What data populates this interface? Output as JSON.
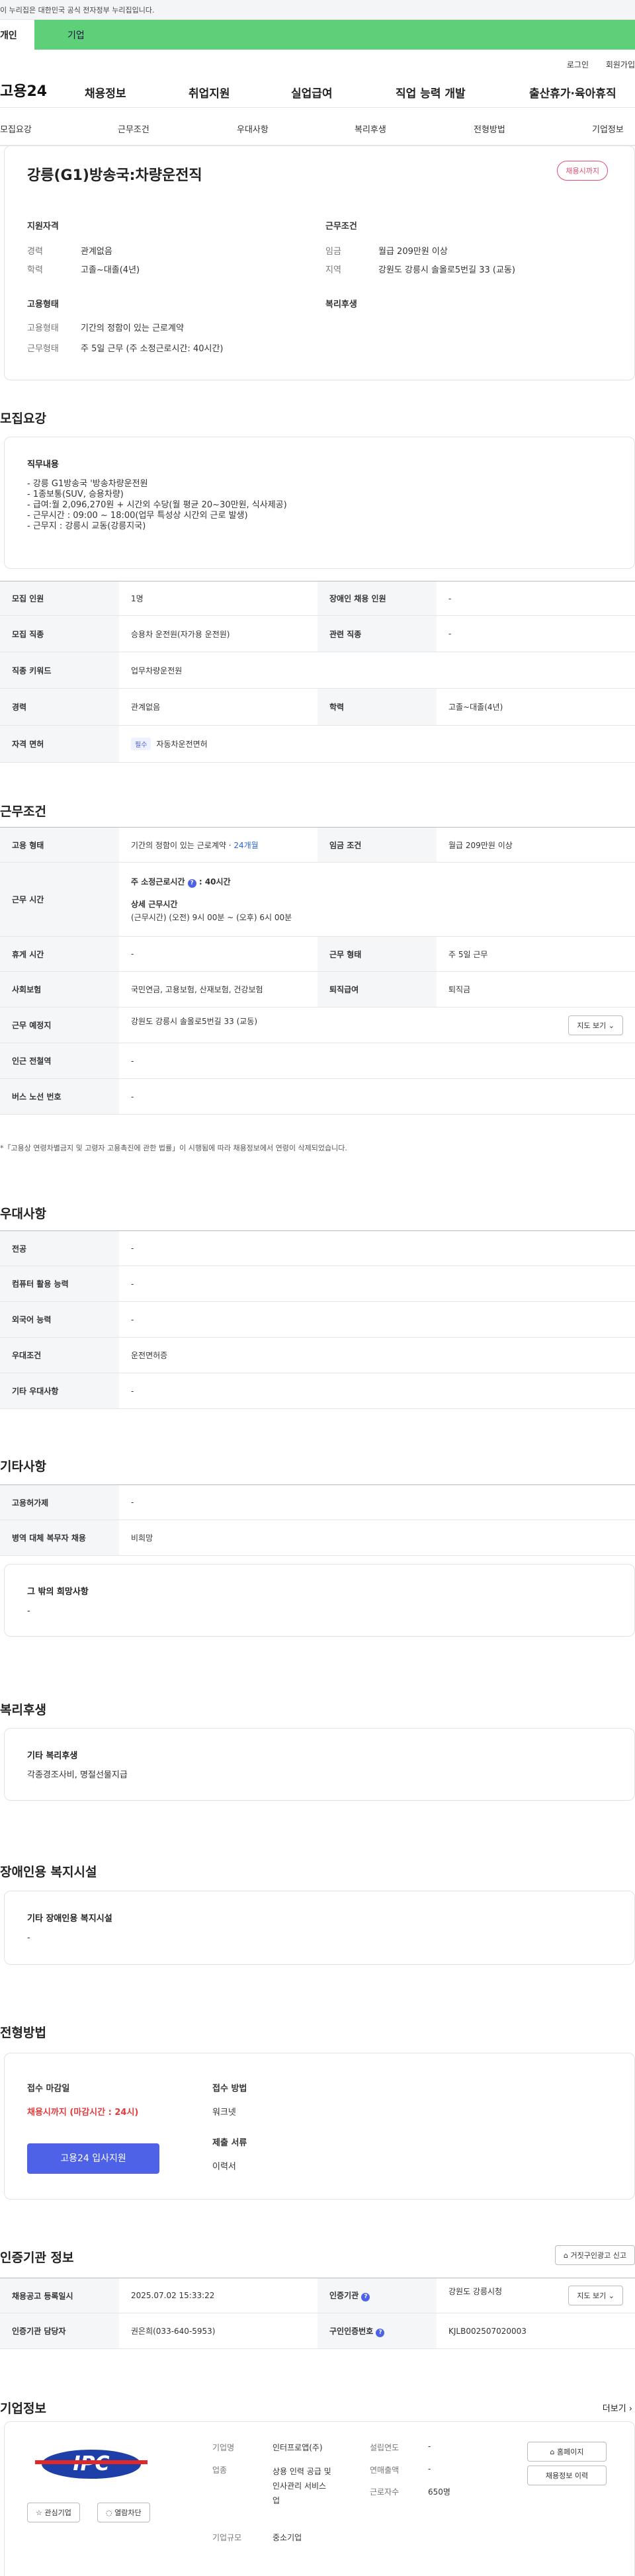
{
  "gov_banner": "이 누리집은 대한민국 공식 전자정부 누리집입니다.",
  "tabs": {
    "personal": "개인",
    "company": "기업"
  },
  "util": {
    "login": "로그인",
    "signup": "회원가입"
  },
  "gnb": {
    "logo": "고용24",
    "menu": [
      "채용정보",
      "취업지원",
      "실업급여",
      "직업 능력 개발",
      "출산휴가·육아휴직"
    ]
  },
  "lnb": [
    "모집요강",
    "근무조건",
    "우대사항",
    "복리후생",
    "전형방법",
    "기업정보"
  ],
  "summary": {
    "title": "강릉(G1)방송국:차량운전직",
    "badge": "채용시까지",
    "qual_h": "지원자격",
    "cond_h": "근무조건",
    "emp_h": "고용형태",
    "welfare_h": "복리후생",
    "career_l": "경력",
    "career_v": "관계없음",
    "edu_l": "학력",
    "edu_v": "고졸~대졸(4년)",
    "wage_l": "임금",
    "wage_v": "월급 209만원 이상",
    "area_l": "지역",
    "area_v": "강원도 강릉시 솔올로5번길 33 (교동)",
    "type_l": "고용형태",
    "type_v": "기간의 정함이 있는 근로계약",
    "work_l": "근무형태",
    "work_v": "주 5일 근무 (주 소정근로시간: 40시간)"
  },
  "recruit": {
    "heading": "모집요강",
    "duty_h": "직무내용",
    "duty": [
      "- 강릉 G1방송국 '방송차량운전원",
      "- 1종보통(SUV, 승용차량)",
      "- 급여:월 2,096,270원 + 시간외 수당(월 평균 20~30만원, 식사제공)",
      "- 근무시간 : 09:00 ~ 18:00(업무 특성상 시간외 근로 발생)",
      "- 근무지 : 강릉시 교동(강릉지국)"
    ],
    "rows": [
      [
        "모집 인원",
        "1명",
        "장애인 채용 인원",
        "-"
      ],
      [
        "모집 직종",
        "승용차 운전원(자가용 운전원)",
        "관련 직종",
        "-"
      ],
      [
        "직종 키워드",
        "업무차량운전원"
      ],
      [
        "경력",
        "관계없음",
        "학력",
        "고졸~대졸(4년)"
      ]
    ],
    "license_l": "자격 면허",
    "license_pill": "필수",
    "license_v": "자동차운전면허"
  },
  "cond": {
    "heading": "근무조건",
    "type_l": "고용 형태",
    "type_v": "기간의 정함이 있는 근로계약 · ",
    "type_link": "24개월",
    "wage_l": "임금 조건",
    "wage_v": "월급 209만원 이상",
    "hours_l": "근무 시간",
    "hours_a": "주 소정근로시간",
    "hours_b": "40시간",
    "hours_c": "상세 근무시간",
    "hours_d": "(근무시간) (오전) 9시 00분 ~ (오후) 6시 00분",
    "rest_l": "휴게 시간",
    "rest_v": "-",
    "form_l": "근무 형태",
    "form_v": "주 5일 근무",
    "ins_l": "사회보험",
    "ins_v": "국민연금, 고용보험, 산재보험, 건강보험",
    "ret_l": "퇴직급여",
    "ret_v": "퇴직금",
    "place_l": "근무 예정지",
    "place_v": "강원도 강릉시 솔올로5번길 33 (교동)",
    "map_btn": "지도 보기 ⌄",
    "subway_l": "인근 전철역",
    "subway_v": "-",
    "bus_l": "버스 노선 번호",
    "bus_v": "-",
    "note": "*「고용상 연령차별금지 및 고령자 고용촉진에 관한 법률」이 시행됨에 따라 채용정보에서 연령이 삭제되었습니다."
  },
  "prefer": {
    "heading": "우대사항",
    "rows": [
      [
        "전공",
        "-"
      ],
      [
        "컴퓨터 활용 능력",
        "-"
      ],
      [
        "외국어 능력",
        "-"
      ],
      [
        "우대조건",
        "운전면허증"
      ],
      [
        "기타 우대사항",
        "-"
      ]
    ]
  },
  "etc": {
    "heading": "기타사항",
    "rows": [
      [
        "고용허가제",
        "-"
      ],
      [
        "병역 대체 복무자 채용",
        "비희망"
      ]
    ],
    "other_h": "그 밖의 희망사항",
    "other_v": "-"
  },
  "welfare": {
    "heading": "복리후생",
    "h": "기타 복리후생",
    "v": "각종경조사비, 명절선물지급"
  },
  "disabled": {
    "heading": "장애인용 복지시설",
    "h": "기타 장애인용 복지시설",
    "v": "-"
  },
  "process": {
    "heading": "전형방법",
    "deadline_h": "접수 마감일",
    "deadline_v": "채용시까지 (마감시간 : 24시)",
    "apply_btn": "고용24 입사지원",
    "method_h": "접수 방법",
    "method_v": "워크넷",
    "docs_h": "제출 서류",
    "docs_v": "이력서"
  },
  "cert": {
    "heading": "인증기관 정보",
    "report_btn": "거짓구인광고 신고",
    "rows": [
      [
        "채용공고 등록일시",
        "2025.07.02 15:33:22",
        "인증기관",
        "강원도 강릉시청"
      ],
      [
        "인증기관 담당자",
        "권은희(033-640-5953)",
        "구인인증번호",
        "KJLB002507020003"
      ]
    ],
    "map_btn": "지도 보기 ⌄"
  },
  "company": {
    "heading": "기업정보",
    "more": "더보기 ›",
    "logo_text": "IPC",
    "fav_btn": "관심기업",
    "block_btn": "열람차단",
    "name_l": "기업명",
    "name_v": "인터프로앱(주)",
    "year_l": "설립연도",
    "year_v": "-",
    "biz_l": "업종",
    "biz_v": [
      "상용 인력 공급 및",
      "인사관리 서비스",
      "업"
    ],
    "sales_l": "연매출액",
    "sales_v": "-",
    "emp_l": "근로자수",
    "emp_v": "650명",
    "size_l": "기업규모",
    "size_v": "중소기업",
    "home_btn": "홈페이지",
    "hist_btn": "채용정보 이력"
  },
  "colors": {
    "green": "#5fd07a",
    "accent": "#4e62e8",
    "badge": "#e54b6c"
  }
}
